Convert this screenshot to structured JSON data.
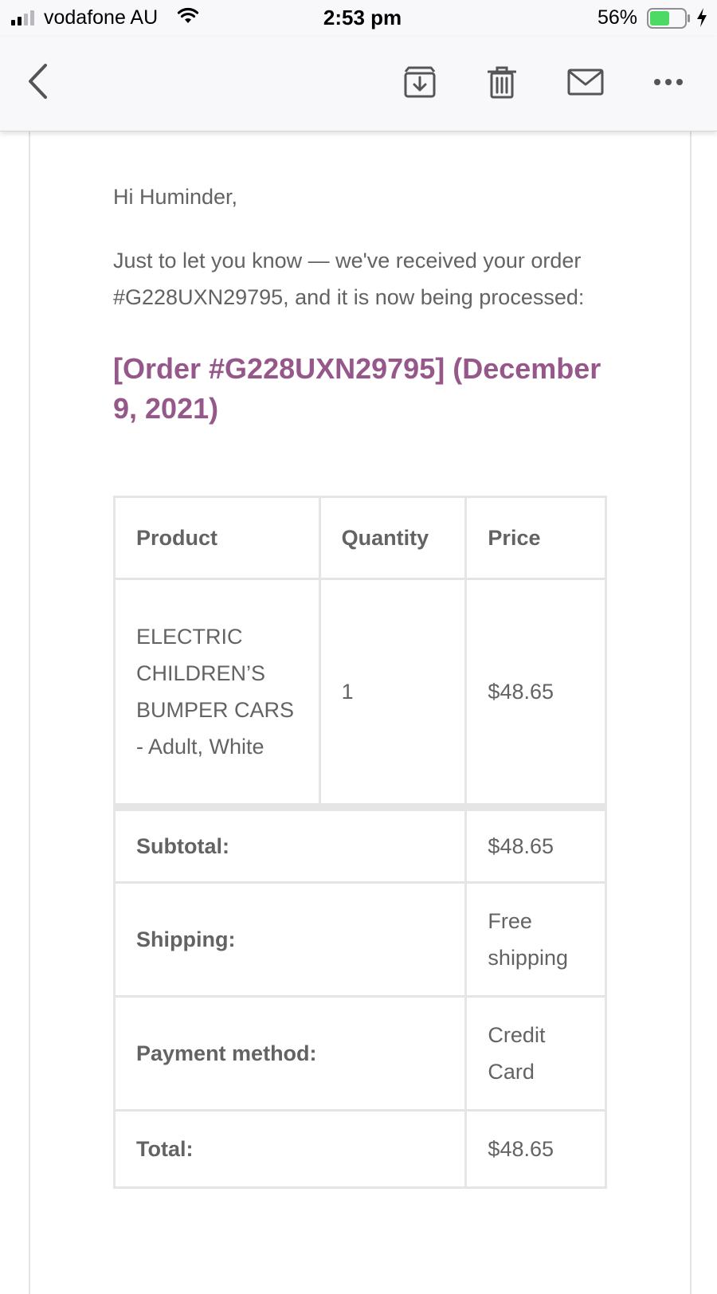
{
  "status_bar": {
    "carrier": "vodafone AU",
    "time": "2:53 pm",
    "battery_percent": "56%",
    "battery_level": 0.56,
    "signal_bars": 2,
    "icons": [
      "signal-icon",
      "wifi-icon",
      "battery-icon",
      "charging-icon"
    ]
  },
  "toolbar": {
    "icons": [
      "back-chevron-icon",
      "archive-icon",
      "trash-icon",
      "mail-icon",
      "more-icon"
    ]
  },
  "email": {
    "greeting": "Hi Huminder,",
    "intro": "Just to let you know — we've received your order #G228UXN29795, and it is now being processed:",
    "order_heading": "[Order #G228UXN29795] (December 9, 2021)",
    "accent_color": "#96588a",
    "table": {
      "headers": {
        "product": "Product",
        "quantity": "Quantity",
        "price": "Price"
      },
      "items": [
        {
          "product": "ELECTRIC CHILDREN’S BUMPER CARS - Adult, White",
          "quantity": "1",
          "price": "$48.65"
        }
      ],
      "totals": {
        "subtotal_label": "Subtotal:",
        "subtotal_value": "$48.65",
        "shipping_label": "Shipping:",
        "shipping_value": "Free shipping",
        "payment_label": "Payment method:",
        "payment_value": "Credit Card",
        "total_label": "Total:",
        "total_value": "$48.65"
      }
    }
  }
}
